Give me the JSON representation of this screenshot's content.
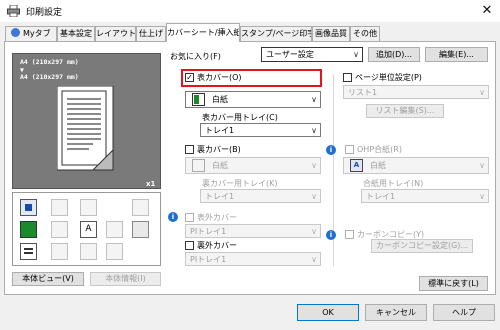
{
  "window": {
    "title": "印刷設定",
    "close_glyph": "✕"
  },
  "tabs": [
    "Myタブ",
    "基本設定",
    "レイアウト",
    "仕上げ",
    "カバーシート/挿入紙",
    "スタンプ/ページ印字",
    "画像品質",
    "その他"
  ],
  "favorites": {
    "label": "お気に入り(F)",
    "value": "ユーザー設定",
    "add_button": "追加(D)...",
    "edit_button": "編集(E)..."
  },
  "preview": {
    "line1": "A4 (210x297 mm)",
    "arrow": "▼",
    "line2": "A4 (210x297 mm)",
    "copies": "x1"
  },
  "left_buttons": {
    "view": "本体ビュー(V)",
    "info": "本体情報(I)"
  },
  "front_cover": {
    "checkbox_label": "表カバー(O)",
    "checked": true,
    "paper_value": "白紙",
    "tray_label": "表カバー用トレイ(C)",
    "tray_value": "トレイ1"
  },
  "back_cover": {
    "checkbox_label": "裏カバー(B)",
    "checked": false,
    "paper_value": "白紙",
    "tray_label": "裏カバー用トレイ(K)",
    "tray_value": "トレイ1"
  },
  "front_outer": {
    "checkbox_label": "表外カバー",
    "tray_value": "PIトレイ1"
  },
  "back_outer": {
    "checkbox_label": "裏外カバー",
    "tray_value": "PIトレイ1"
  },
  "per_page": {
    "checkbox_label": "ページ単位設定(P)",
    "list_value": "リスト1",
    "edit_button": "リスト編集(S)..."
  },
  "ohp": {
    "checkbox_label": "OHP合紙(R)",
    "paper_value": "白紙",
    "tray_label": "合紙用トレイ(N)",
    "tray_value": "トレイ1"
  },
  "carbon": {
    "checkbox_label": "カーボンコピー(Y)",
    "settings_button": "カーボンコピー設定(G)..."
  },
  "restore_button": "標準に戻す(L)",
  "footer": {
    "ok": "OK",
    "cancel": "キャンセル",
    "help": "ヘルプ"
  },
  "check_glyph": "✓",
  "dropdown_arrow": "∨",
  "info_glyph": "i",
  "colors": {
    "highlight_border": "#e8141b",
    "info_icon": "#1e6fd0"
  }
}
